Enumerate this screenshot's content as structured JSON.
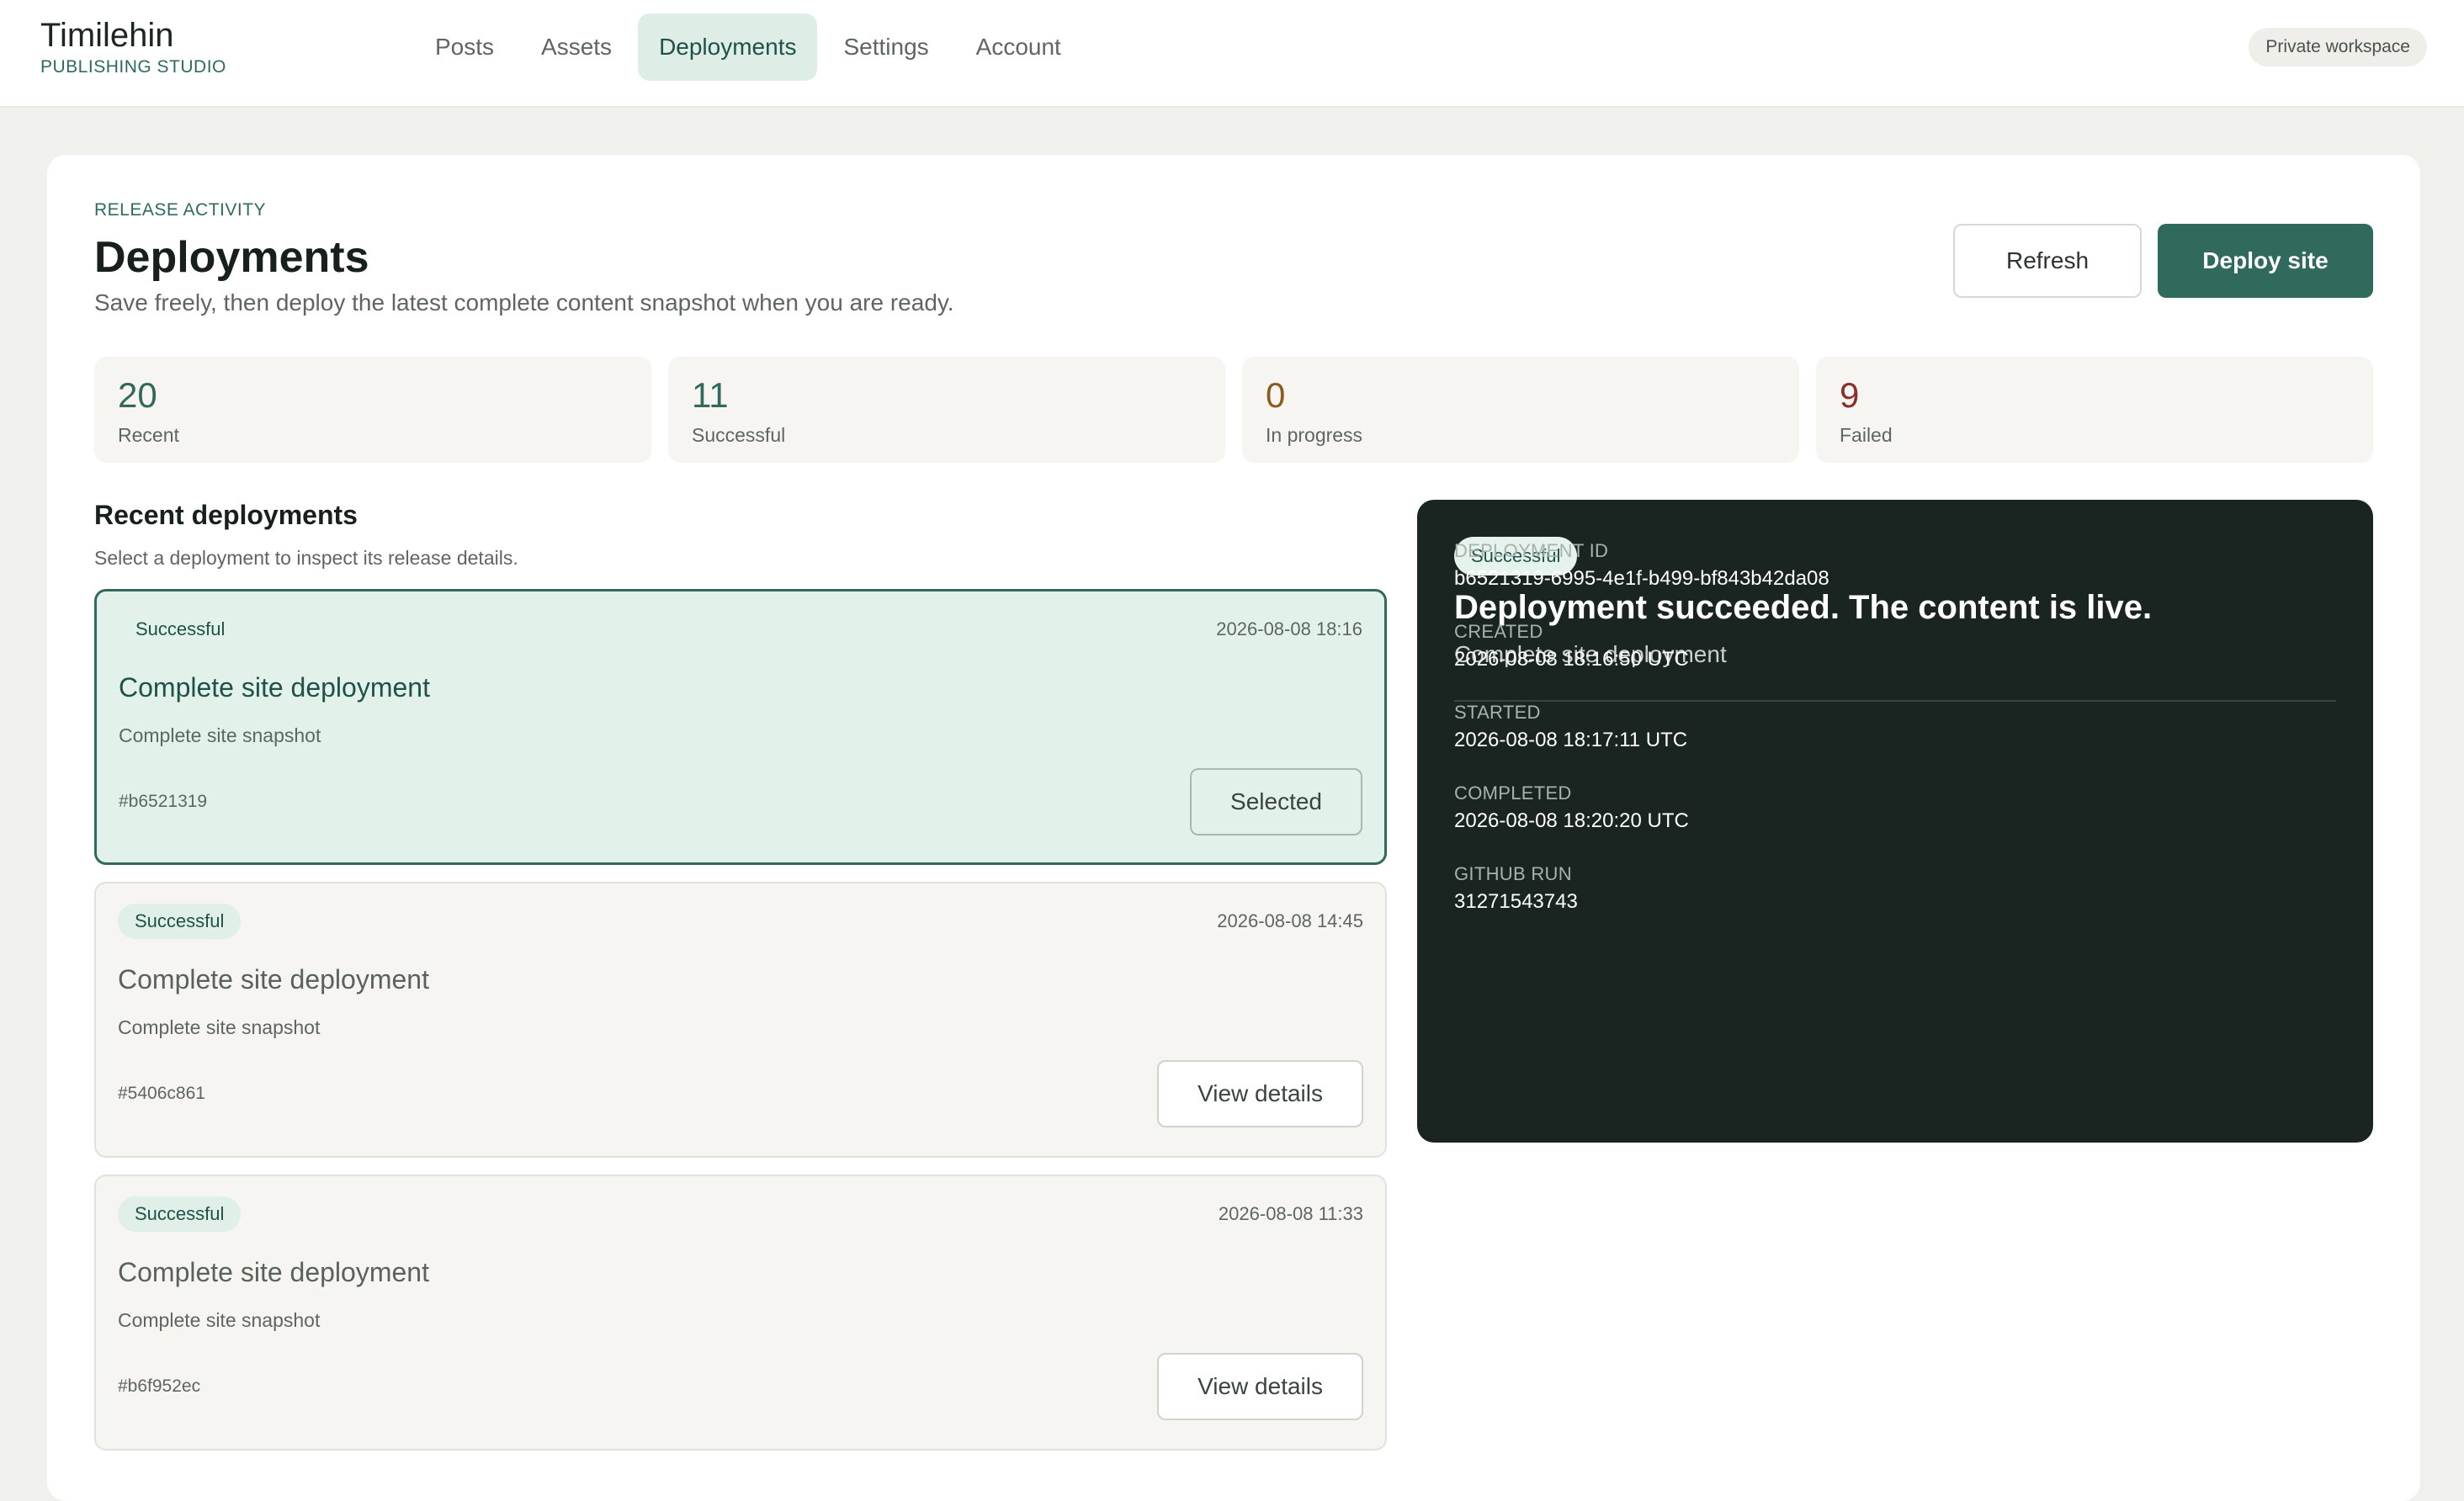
{
  "brand": {
    "name": "Timilehin",
    "subtitle": "PUBLISHING STUDIO"
  },
  "nav": {
    "items": [
      {
        "label": "Posts",
        "active": false
      },
      {
        "label": "Assets",
        "active": false
      },
      {
        "label": "Deployments",
        "active": true
      },
      {
        "label": "Settings",
        "active": false
      },
      {
        "label": "Account",
        "active": false
      }
    ]
  },
  "workspace_badge": "Private workspace",
  "header": {
    "eyebrow": "RELEASE ACTIVITY",
    "title": "Deployments",
    "subtitle": "Save freely, then deploy the latest complete content snapshot when you are ready.",
    "refresh_label": "Refresh",
    "deploy_label": "Deploy site"
  },
  "stats": [
    {
      "value": "20",
      "label": "Recent",
      "color": "#2f6a5c"
    },
    {
      "value": "11",
      "label": "Successful",
      "color": "#2f6a5c"
    },
    {
      "value": "0",
      "label": "In progress",
      "color": "#8a5a1f"
    },
    {
      "value": "9",
      "label": "Failed",
      "color": "#8a2f2a"
    }
  ],
  "recent": {
    "title": "Recent deployments",
    "subtitle": "Select a deployment to inspect its release details.",
    "items": [
      {
        "status": "Successful",
        "time": "2026-08-08 18:16",
        "title": "Complete site deployment",
        "description": "Complete site snapshot",
        "hash": "#b6521319",
        "button": "Selected",
        "selected": true
      },
      {
        "status": "Successful",
        "time": "2026-08-08 14:45",
        "title": "Complete site deployment",
        "description": "Complete site snapshot",
        "hash": "#5406c861",
        "button": "View details",
        "selected": false
      },
      {
        "status": "Successful",
        "time": "2026-08-08 11:33",
        "title": "Complete site deployment",
        "description": "Complete site snapshot",
        "hash": "#b6f952ec",
        "button": "View details",
        "selected": false
      }
    ]
  },
  "detail": {
    "status": "Successful",
    "heading": "Deployment succeeded. The content is live.",
    "subheading": "Complete site deployment",
    "fields": [
      {
        "label": "DEPLOYMENT ID",
        "value": "b6521319-6995-4e1f-b499-bf843b42da08"
      },
      {
        "label": "CREATED",
        "value": "2026-08-08 18:16:50 UTC"
      },
      {
        "label": "STARTED",
        "value": "2026-08-08 18:17:11 UTC"
      },
      {
        "label": "COMPLETED",
        "value": "2026-08-08 18:20:20 UTC"
      },
      {
        "label": "GITHUB RUN",
        "value": "31271543743"
      }
    ]
  }
}
